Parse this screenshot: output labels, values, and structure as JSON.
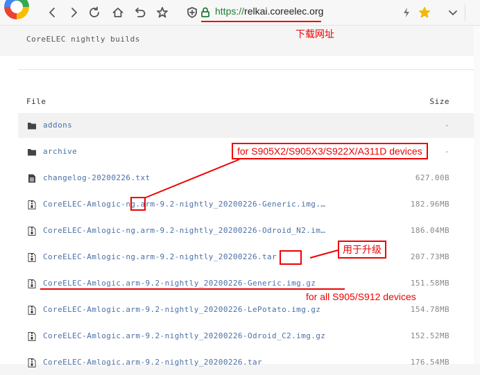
{
  "browser": {
    "url_protocol": "https://",
    "url_host": "relkai.coreelec.org"
  },
  "page": {
    "site_title": "CoreELEC nightly builds",
    "col_file": "File",
    "col_size": "Size"
  },
  "files": [
    {
      "icon": "folder-icon",
      "name": "addons",
      "size": "-"
    },
    {
      "icon": "folder-icon",
      "name": "archive",
      "size": "-"
    },
    {
      "icon": "text-file-icon",
      "name": "changelog-20200226.txt",
      "size": "627.00B"
    },
    {
      "icon": "archive-file-icon",
      "name": "CoreELEC-Amlogic-ng.arm-9.2-nightly_20200226-Generic.img.…",
      "size": "182.96MB"
    },
    {
      "icon": "archive-file-icon",
      "name": "CoreELEC-Amlogic-ng.arm-9.2-nightly_20200226-Odroid_N2.im…",
      "size": "186.04MB"
    },
    {
      "icon": "archive-file-icon",
      "name": "CoreELEC-Amlogic-ng.arm-9.2-nightly_20200226.tar",
      "size": "207.73MB"
    },
    {
      "icon": "archive-file-icon",
      "name": "CoreELEC-Amlogic.arm-9.2-nightly_20200226-Generic.img.gz",
      "size": "151.58MB"
    },
    {
      "icon": "archive-file-icon",
      "name": "CoreELEC-Amlogic.arm-9.2-nightly_20200226-LePotato.img.gz",
      "size": "154.78MB"
    },
    {
      "icon": "archive-file-icon",
      "name": "CoreELEC-Amlogic.arm-9.2-nightly_20200226-Odroid_C2.img.gz",
      "size": "152.52MB"
    },
    {
      "icon": "archive-file-icon",
      "name": "CoreELEC-Amlogic.arm-9.2-nightly_20200226.tar",
      "size": "176.54MB"
    }
  ],
  "annotations": {
    "download_url": "下载网址",
    "ng_devices": "for S905X2/S905X3/S922X/A311D devices",
    "upgrade": "用于升级",
    "all_devices": "for all S905/S912 devices",
    "color": "#e00000"
  }
}
